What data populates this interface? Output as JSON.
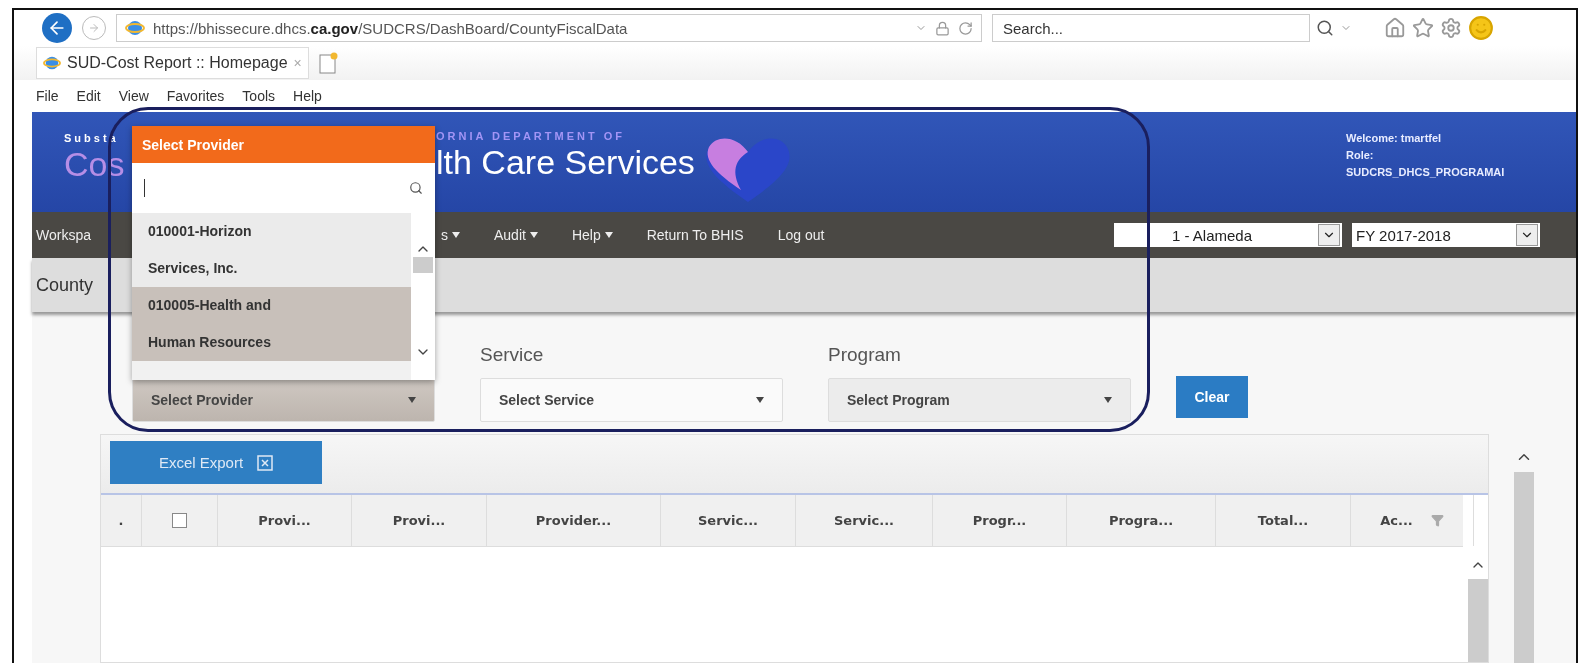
{
  "browser": {
    "address": {
      "prefix": "https://bhissecure.dhcs.",
      "domain": "ca.gov",
      "path": "/SUDCRS/DashBoard/CountyFiscalData"
    },
    "search_placeholder": "Search...",
    "tab": {
      "title": "SUD-Cost Report :: Homepage",
      "close": "×"
    },
    "menu": [
      "File",
      "Edit",
      "View",
      "Favorites",
      "Tools",
      "Help"
    ]
  },
  "header": {
    "left_small": "Substa",
    "left_large": "Cos",
    "dept_small": "ORNIA DEPARTMENT OF",
    "dept_large": "lth Care Services",
    "welcome": "Welcome: tmartfel",
    "role_label": "Role:",
    "role": "SUDCRS_DHCS_PROGRAMAI"
  },
  "nav": {
    "items": [
      {
        "label": "Workspa",
        "caret": false
      },
      {
        "label": "s",
        "caret": true
      },
      {
        "label": "Audit",
        "caret": true
      },
      {
        "label": "Help",
        "caret": true
      },
      {
        "label": "Return To BHIS",
        "caret": false
      },
      {
        "label": "Log out",
        "caret": false
      }
    ],
    "county": "1 - Alameda",
    "fiscal_year": "FY 2017-2018"
  },
  "breadcrumb": "County",
  "filters": [
    {
      "value": "Select Provider",
      "open": true,
      "disabled": false
    },
    {
      "label": "Service",
      "value": "Select Service",
      "open": false,
      "disabled": false
    },
    {
      "label": "Program",
      "value": "Select Program",
      "open": false,
      "disabled": true
    }
  ],
  "clear_button": "Clear",
  "dropdown": {
    "title": "Select Provider",
    "items": [
      {
        "label": "010001-Horizon\nServices, Inc.",
        "selected": false
      },
      {
        "label": "010005-Health and\nHuman Resources",
        "selected": true
      }
    ]
  },
  "grid": {
    "export_button": "Excel Export",
    "select_all_checked": false,
    "columns": [
      {
        "label": ".",
        "filter": false
      },
      {
        "label": "Provi...",
        "filter": false
      },
      {
        "label": "Provi...",
        "filter": false
      },
      {
        "label": "Provider...",
        "filter": false
      },
      {
        "label": "Servic...",
        "filter": false
      },
      {
        "label": "Servic...",
        "filter": false
      },
      {
        "label": "Progr...",
        "filter": false
      },
      {
        "label": "Progra...",
        "filter": false
      },
      {
        "label": "Total...",
        "filter": false
      },
      {
        "label": "Ac...",
        "filter": true
      }
    ]
  }
}
